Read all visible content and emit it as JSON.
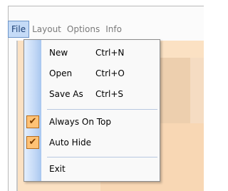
{
  "menubar": {
    "items": [
      {
        "label": "File",
        "active": true
      },
      {
        "label": "Layout",
        "active": false
      },
      {
        "label": "Options",
        "active": false
      },
      {
        "label": "Info",
        "active": false
      }
    ]
  },
  "file_menu": {
    "items": [
      {
        "label": "New",
        "shortcut": "Ctrl+N"
      },
      {
        "label": "Open",
        "shortcut": "Ctrl+O"
      },
      {
        "label": "Save As",
        "shortcut": "Ctrl+S"
      },
      {
        "label": "Always On Top",
        "checked": true
      },
      {
        "label": "Auto Hide",
        "checked": true
      },
      {
        "label": "Exit"
      }
    ],
    "check_glyph": "✔"
  },
  "colors": {
    "menu_active_bg": "#c5dbf7",
    "check_bg": "#ffc275",
    "content_bg": "#fbe1c3"
  }
}
